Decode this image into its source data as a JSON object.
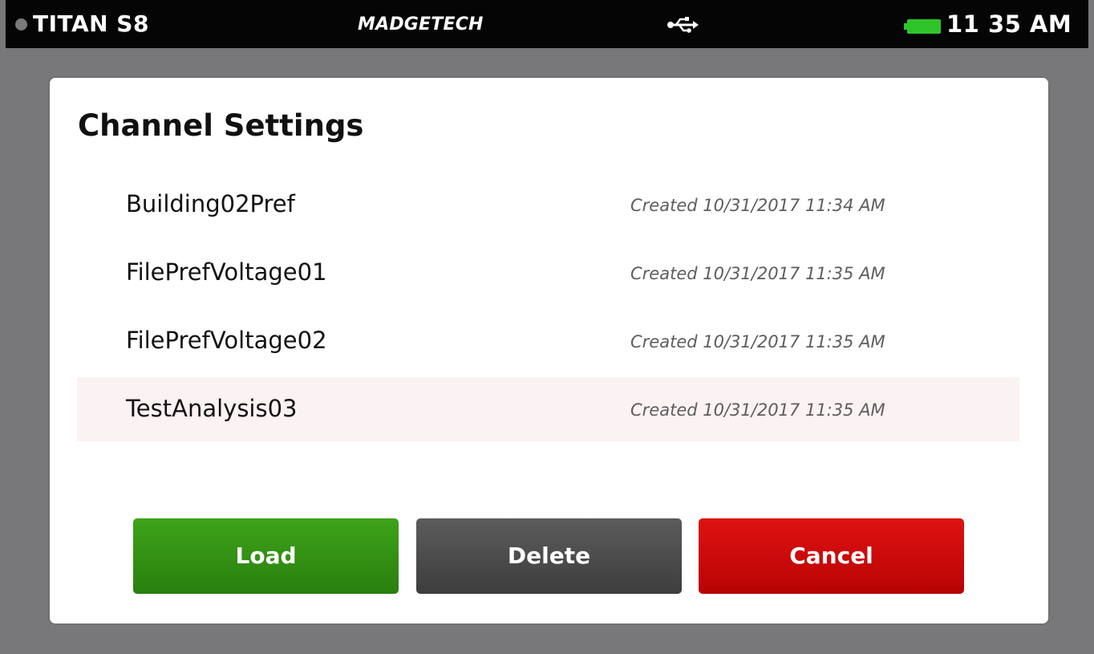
{
  "status_bar": {
    "device_name": "TITAN S8",
    "brand": "MADGETECH",
    "usb_icon": "usb-icon",
    "battery_icon": "battery-icon",
    "battery_color": "#2ec52a",
    "time": "11 35 AM"
  },
  "dialog": {
    "title": "Channel Settings",
    "files": [
      {
        "name": "Building02Pref",
        "created": "Created 10/31/2017 11:34 AM",
        "selected": false
      },
      {
        "name": "FilePrefVoltage01",
        "created": "Created 10/31/2017 11:35 AM",
        "selected": false
      },
      {
        "name": "FilePrefVoltage02",
        "created": "Created 10/31/2017 11:35 AM",
        "selected": false
      },
      {
        "name": "TestAnalysis03",
        "created": "Created 10/31/2017 11:35 AM",
        "selected": true
      }
    ],
    "buttons": {
      "load": "Load",
      "delete": "Delete",
      "cancel": "Cancel"
    }
  },
  "colors": {
    "load": "#2f8f12",
    "delete": "#4a4a4a",
    "cancel": "#cc0808",
    "selected_row": "#fbf2f3"
  }
}
